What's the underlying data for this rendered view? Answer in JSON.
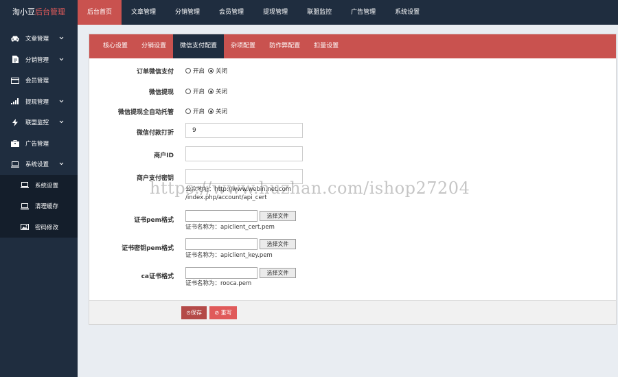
{
  "app": {
    "brand_main": "淘小豆",
    "brand_accent": "后台管理"
  },
  "topnav": [
    "后台首页",
    "文章管理",
    "分销管理",
    "会员管理",
    "提现管理",
    "联盟监控",
    "广告管理",
    "系统设置"
  ],
  "sidebar": {
    "items": [
      {
        "label": "文章管理",
        "icon": "car-icon"
      },
      {
        "label": "分销管理",
        "icon": "file-icon"
      },
      {
        "label": "会员管理",
        "icon": "card-icon"
      },
      {
        "label": "提现管理",
        "icon": "signal-icon"
      },
      {
        "label": "联盟监控",
        "icon": "bolt-icon"
      },
      {
        "label": "广告管理",
        "icon": "briefcase-icon"
      },
      {
        "label": "系统设置",
        "icon": "laptop-icon"
      }
    ],
    "sub_items": [
      {
        "label": "系统设置",
        "icon": "laptop-icon"
      },
      {
        "label": "清理缓存",
        "icon": "laptop-icon"
      },
      {
        "label": "密码修改",
        "icon": "image-icon"
      }
    ]
  },
  "tabs": [
    "核心设置",
    "分销设置",
    "微信支付配置",
    "杂项配置",
    "防作弊配置",
    "扣量设置"
  ],
  "form": {
    "order_wx_pay": {
      "label": "订单微信支付",
      "on": "开启",
      "off": "关闭",
      "selected": "关闭"
    },
    "wx_withdraw": {
      "label": "微信提现",
      "on": "开启",
      "off": "关闭",
      "selected": "关闭"
    },
    "wx_withdraw_auto": {
      "label": "微信提现全自动托管",
      "on": "开启",
      "off": "关闭",
      "selected": "关闭"
    },
    "wx_discount": {
      "label": "微信付款打折",
      "value": "9"
    },
    "merchant_id": {
      "label": "商户ID",
      "value": ""
    },
    "merchant_key": {
      "label": "商户支付密钥",
      "value": "",
      "hint_line1": "公众地址：http://www.webin.net.com",
      "hint_line2": "/index.php/account/api_cert"
    },
    "cert_pem": {
      "label": "证书pem格式",
      "button": "选择文件",
      "note": "证书名称为：apiclient_cert.pem"
    },
    "key_pem": {
      "label": "证书密钥pem格式",
      "button": "选择文件",
      "note": "证书名称为：apiclient_key.pem"
    },
    "ca_cert": {
      "label": "ca证书格式",
      "button": "选择文件",
      "note": "证书名称为：rooca.pem"
    }
  },
  "actions": {
    "save": "⊙保存",
    "reset": "⊘ 重写"
  },
  "watermark": "https://www.huzhan.com/ishop27204",
  "colors": {
    "dark_nav": "#1f2d3f",
    "accent_red": "#c9524f",
    "save_btn": "#b44a48",
    "reset_btn": "#e05a5a"
  }
}
